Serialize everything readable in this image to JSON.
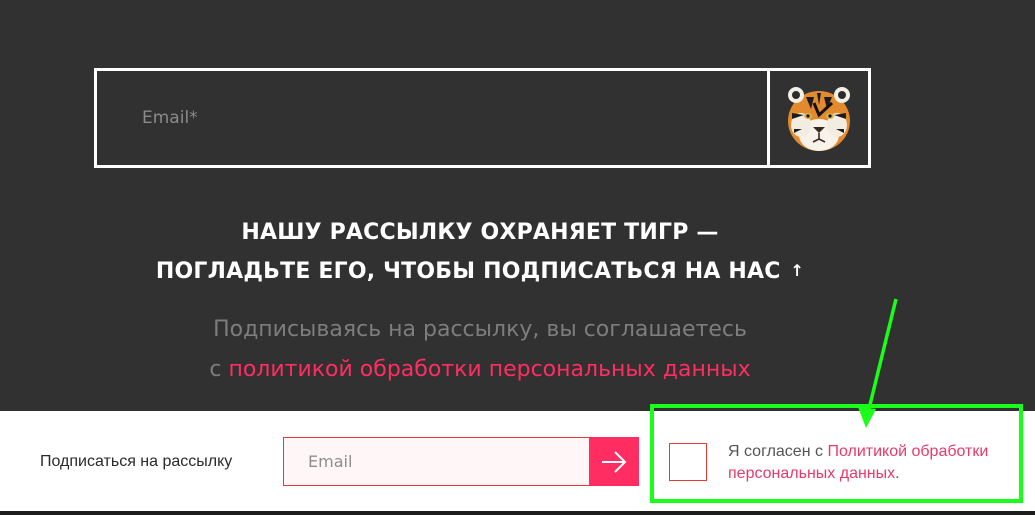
{
  "hero": {
    "email_placeholder": "Email*",
    "headline_line1": "НАШУ РАССЫЛКУ ОХРАНЯЕТ ТИГР —",
    "headline_line2": "ПОГЛАДЬТЕ ЕГО, ЧТОБЫ ПОДПИСАТЬСЯ НА НАС",
    "headline_arrow": "↑",
    "agree_line1": "Подписываясь на рассылку, вы соглашаетесь",
    "agree_prefix": "с",
    "agree_link": "политикой обработки персональных данных"
  },
  "footer": {
    "subscribe_label": "Подписаться на рассылку",
    "email_placeholder": "Email",
    "submit_icon": "arrow-right-icon",
    "consent_prefix": "Я согласен с",
    "consent_link": "Политикой обработки персональных данных",
    "consent_suffix": "."
  },
  "colors": {
    "background": "#313131",
    "accent": "#ff2d62",
    "annotation": "#19ff19"
  }
}
